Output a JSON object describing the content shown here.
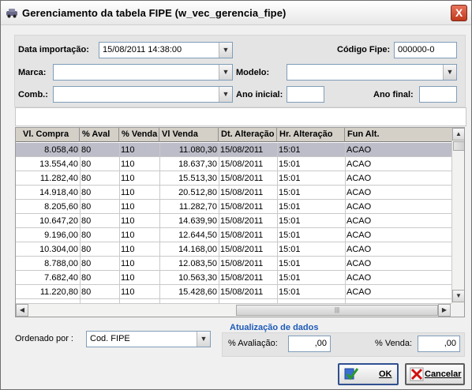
{
  "window": {
    "title": "Gerenciamento da tabela FIPE (w_vec_gerencia_fipe)",
    "close_label": "X"
  },
  "filters": {
    "data_importacao_label": "Data importação:",
    "data_importacao_value": "15/08/2011 14:38:00",
    "codigo_fipe_label": "Código Fipe:",
    "codigo_fipe_value": "000000-0",
    "marca_label": "Marca:",
    "marca_value": "",
    "modelo_label": "Modelo:",
    "modelo_value": "",
    "comb_label": "Comb.:",
    "comb_value": "",
    "ano_inicial_label": "Ano inicial:",
    "ano_inicial_value": "",
    "ano_final_label": "Ano final:",
    "ano_final_value": ""
  },
  "grid": {
    "columns": [
      "Vl. Compra",
      "% Aval",
      "% Venda",
      "Vl Venda",
      "Dt. Alteração",
      "Hr. Alteração",
      "Fun Alt."
    ],
    "rows": [
      [
        "8.058,40",
        "80",
        "110",
        "11.080,30",
        "15/08/2011",
        "15:01",
        "ACAO"
      ],
      [
        "13.554,40",
        "80",
        "110",
        "18.637,30",
        "15/08/2011",
        "15:01",
        "ACAO"
      ],
      [
        "11.282,40",
        "80",
        "110",
        "15.513,30",
        "15/08/2011",
        "15:01",
        "ACAO"
      ],
      [
        "14.918,40",
        "80",
        "110",
        "20.512,80",
        "15/08/2011",
        "15:01",
        "ACAO"
      ],
      [
        "8.205,60",
        "80",
        "110",
        "11.282,70",
        "15/08/2011",
        "15:01",
        "ACAO"
      ],
      [
        "10.647,20",
        "80",
        "110",
        "14.639,90",
        "15/08/2011",
        "15:01",
        "ACAO"
      ],
      [
        "9.196,00",
        "80",
        "110",
        "12.644,50",
        "15/08/2011",
        "15:01",
        "ACAO"
      ],
      [
        "10.304,00",
        "80",
        "110",
        "14.168,00",
        "15/08/2011",
        "15:01",
        "ACAO"
      ],
      [
        "8.788,00",
        "80",
        "110",
        "12.083,50",
        "15/08/2011",
        "15:01",
        "ACAO"
      ],
      [
        "7.682,40",
        "80",
        "110",
        "10.563,30",
        "15/08/2011",
        "15:01",
        "ACAO"
      ],
      [
        "11.220,80",
        "80",
        "110",
        "15.428,60",
        "15/08/2011",
        "15:01",
        "ACAO"
      ]
    ],
    "selected_row": 0
  },
  "bottom": {
    "ordenado_label": "Ordenado por :",
    "ordenado_value": "Cod. FIPE",
    "group_title": "Atualização de dados",
    "avaliacao_label": "% Avaliação:",
    "avaliacao_value": ",00",
    "venda_label": "% Venda:",
    "venda_value": ",00"
  },
  "buttons": {
    "ok_label": "OK",
    "cancel_label": "Cancelar"
  },
  "colors": {
    "selected_row": "#bdbdc9",
    "group_title": "#1e5bb8"
  }
}
